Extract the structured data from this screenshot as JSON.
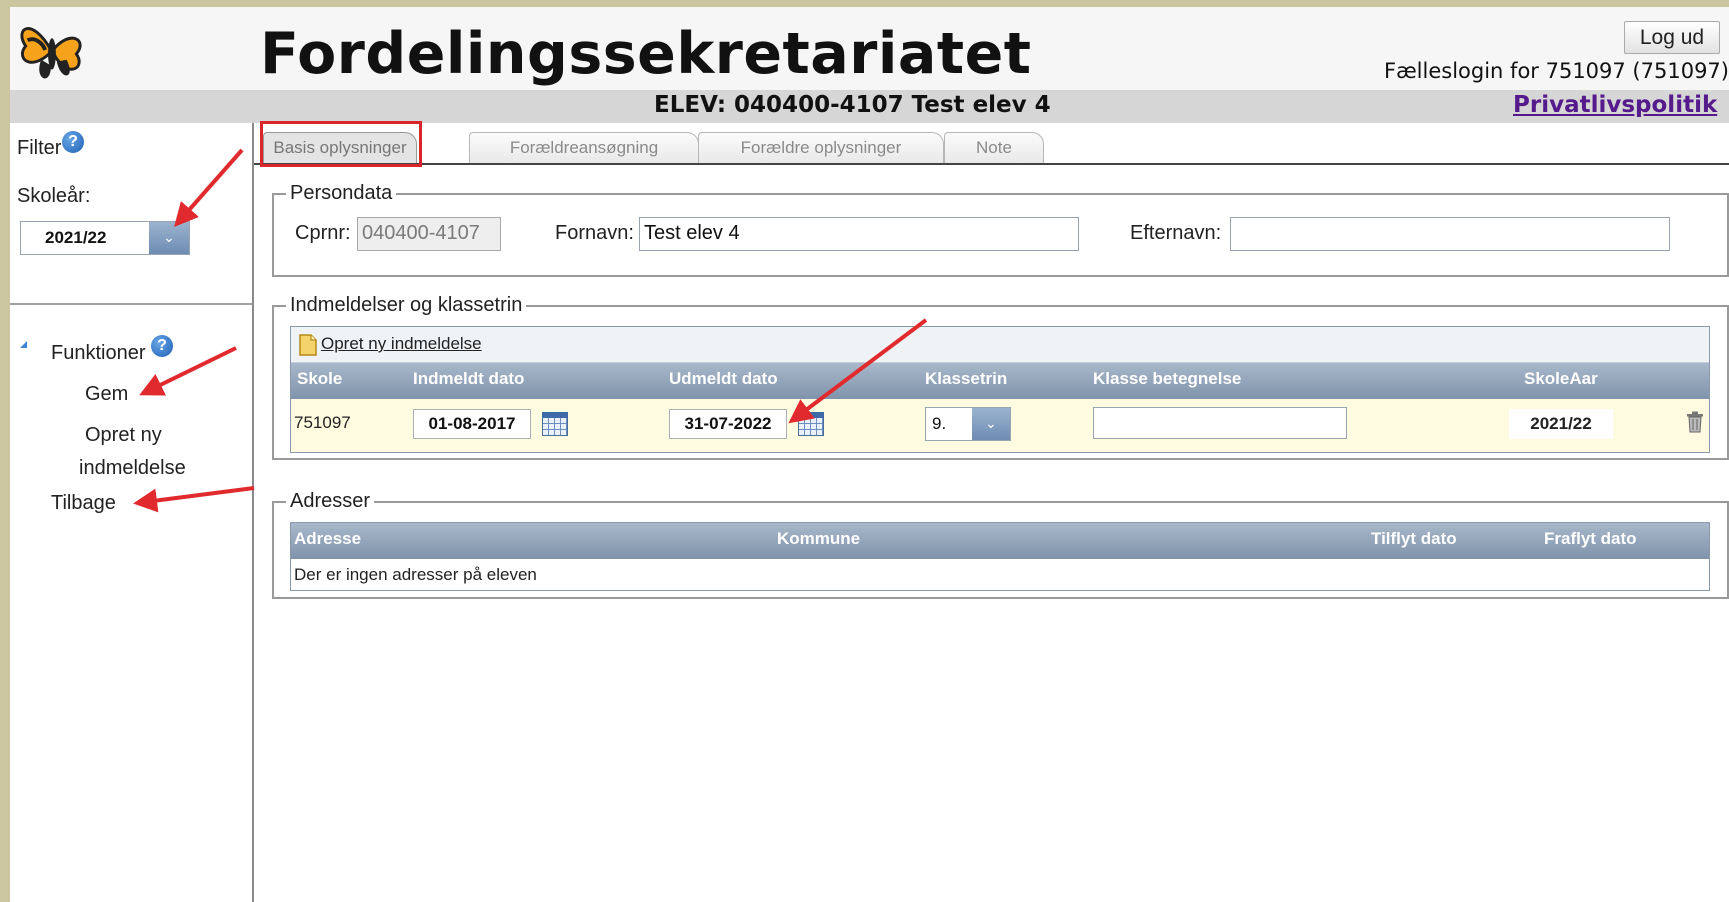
{
  "header": {
    "title": "Fordelingssekretariatet",
    "logout_label": "Log ud",
    "login_info": "Fælleslogin for 751097 (751097)",
    "logo_icon": "butterfly-logo-icon"
  },
  "subheader": {
    "student_title": "ELEV: 040400-4107 Test elev 4",
    "privacy_link": "Privatlivspolitik"
  },
  "sidebar": {
    "filter_label": "Filter",
    "school_year_label": "Skoleår:",
    "school_year_value": "2021/22",
    "functions_label": "Funktioner",
    "items": [
      {
        "label": "Gem"
      },
      {
        "label": "Opret ny"
      },
      {
        "label": "indmeldelse"
      },
      {
        "label": "Tilbage"
      }
    ]
  },
  "tabs": [
    {
      "label": "Basis oplysninger",
      "active": true
    },
    {
      "label": "Forældreansøgning",
      "active": false
    },
    {
      "label": "Forældre oplysninger",
      "active": false
    },
    {
      "label": "Note",
      "active": false
    }
  ],
  "persondata": {
    "legend": "Persondata",
    "cpr_label": "Cprnr:",
    "cpr_value": "040400-4107",
    "firstname_label": "Fornavn:",
    "firstname_value": "Test elev 4",
    "lastname_label": "Efternavn:",
    "lastname_value": ""
  },
  "enrollments": {
    "legend": "Indmeldelser og klassetrin",
    "create_link": "Opret ny indmeldelse",
    "columns": [
      "Skole",
      "Indmeldt dato",
      "Udmeldt dato",
      "Klassetrin",
      "Klasse betegnelse",
      "SkoleAar"
    ],
    "rows": [
      {
        "school": "751097",
        "enrolled": "01-08-2017",
        "unenrolled": "31-07-2022",
        "grade": "9.",
        "class_name": "",
        "school_year": "2021/22"
      }
    ]
  },
  "addresses": {
    "legend": "Adresser",
    "columns": [
      "Adresse",
      "Kommune",
      "Tilflyt dato",
      "Fraflyt dato"
    ],
    "empty_text": "Der er ingen adresser på eleven"
  },
  "colors": {
    "accent_red": "#d9262b",
    "grid_header": "#8a9db4",
    "row_highlight": "#fffbe0",
    "link_visited": "#551a8b"
  }
}
